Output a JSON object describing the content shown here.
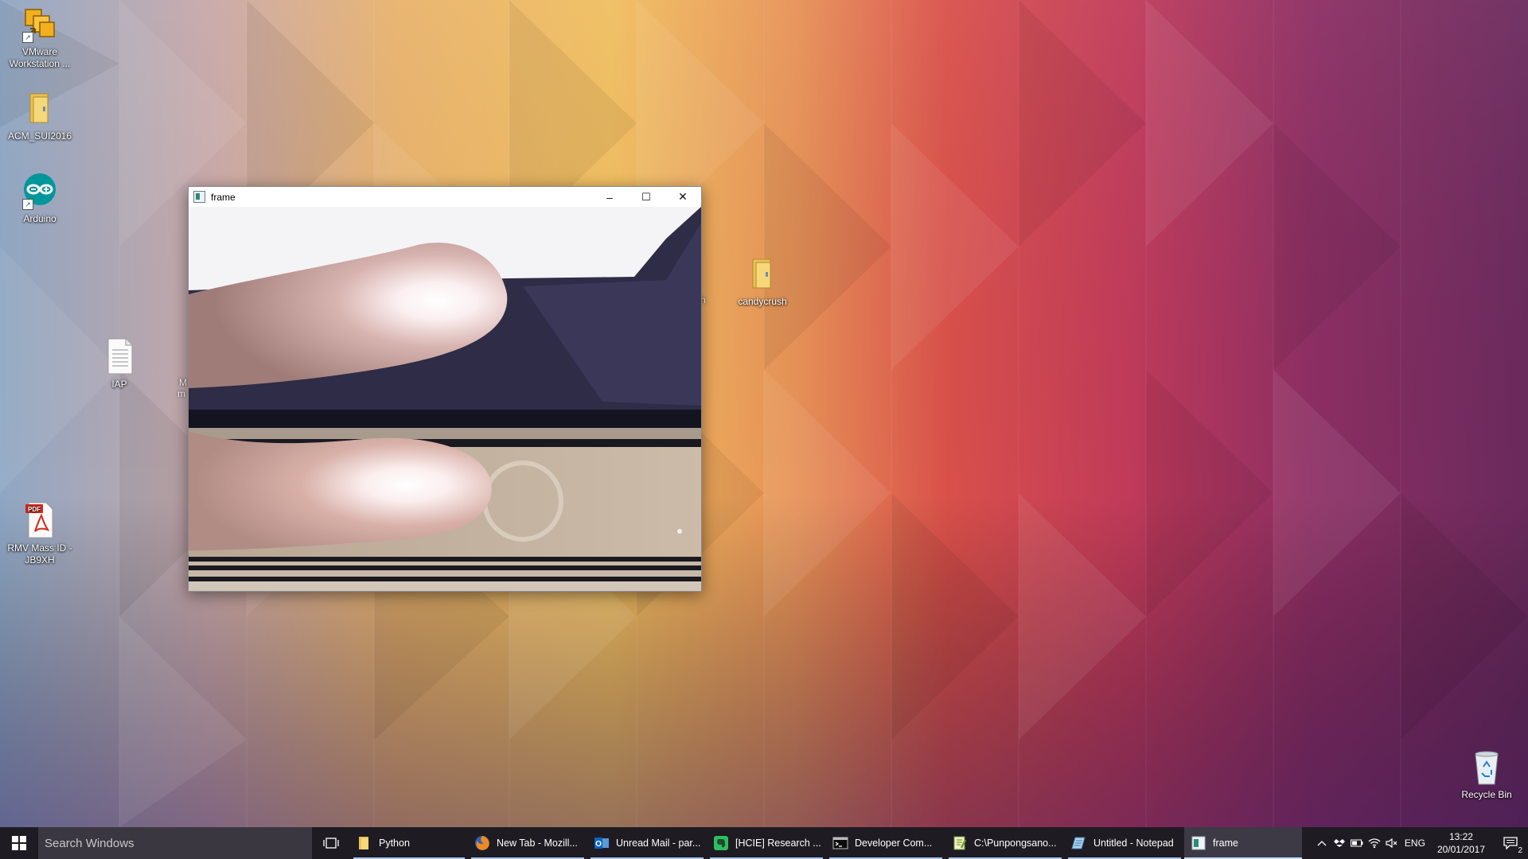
{
  "desktop": {
    "icons": [
      {
        "label": "VMware Workstation ...",
        "icon": "vmware-icon"
      },
      {
        "label": "ACM_SUI2016",
        "icon": "folder-icon"
      },
      {
        "label": "Arduino",
        "icon": "arduino-icon"
      },
      {
        "label": "IAP",
        "icon": "text-file-icon"
      },
      {
        "label": "RMV Mass ID - JB9XH",
        "icon": "pdf-icon"
      },
      {
        "label": "candycrush",
        "icon": "folder-icon"
      },
      {
        "label": "Recycle Bin",
        "icon": "recycle-bin-icon"
      }
    ],
    "partial_labels": {
      "left_fragment": "M",
      "left_fragment_2": "m",
      "right_fragment": "h"
    }
  },
  "window": {
    "title": "frame",
    "controls": {
      "minimize": "–",
      "maximize": "☐",
      "close": "✕"
    }
  },
  "taskbar": {
    "search_placeholder": "Search Windows",
    "items": [
      {
        "label": "Python",
        "icon": "folder-icon"
      },
      {
        "label": "New Tab - Mozill...",
        "icon": "firefox-icon"
      },
      {
        "label": "Unread Mail - par...",
        "icon": "outlook-icon"
      },
      {
        "label": "[HCIE] Research ...",
        "icon": "evernote-icon"
      },
      {
        "label": "Developer Com...",
        "icon": "command-prompt-icon"
      },
      {
        "label": "C:\\Punpongsano...",
        "icon": "notepadpp-icon"
      },
      {
        "label": "Untitled - Notepad",
        "icon": "notepad-icon"
      },
      {
        "label": "frame",
        "icon": "opencv-window-icon"
      }
    ],
    "tray": {
      "language": "ENG",
      "time": "13:22",
      "date": "20/01/2017",
      "notification_count": "2"
    }
  }
}
